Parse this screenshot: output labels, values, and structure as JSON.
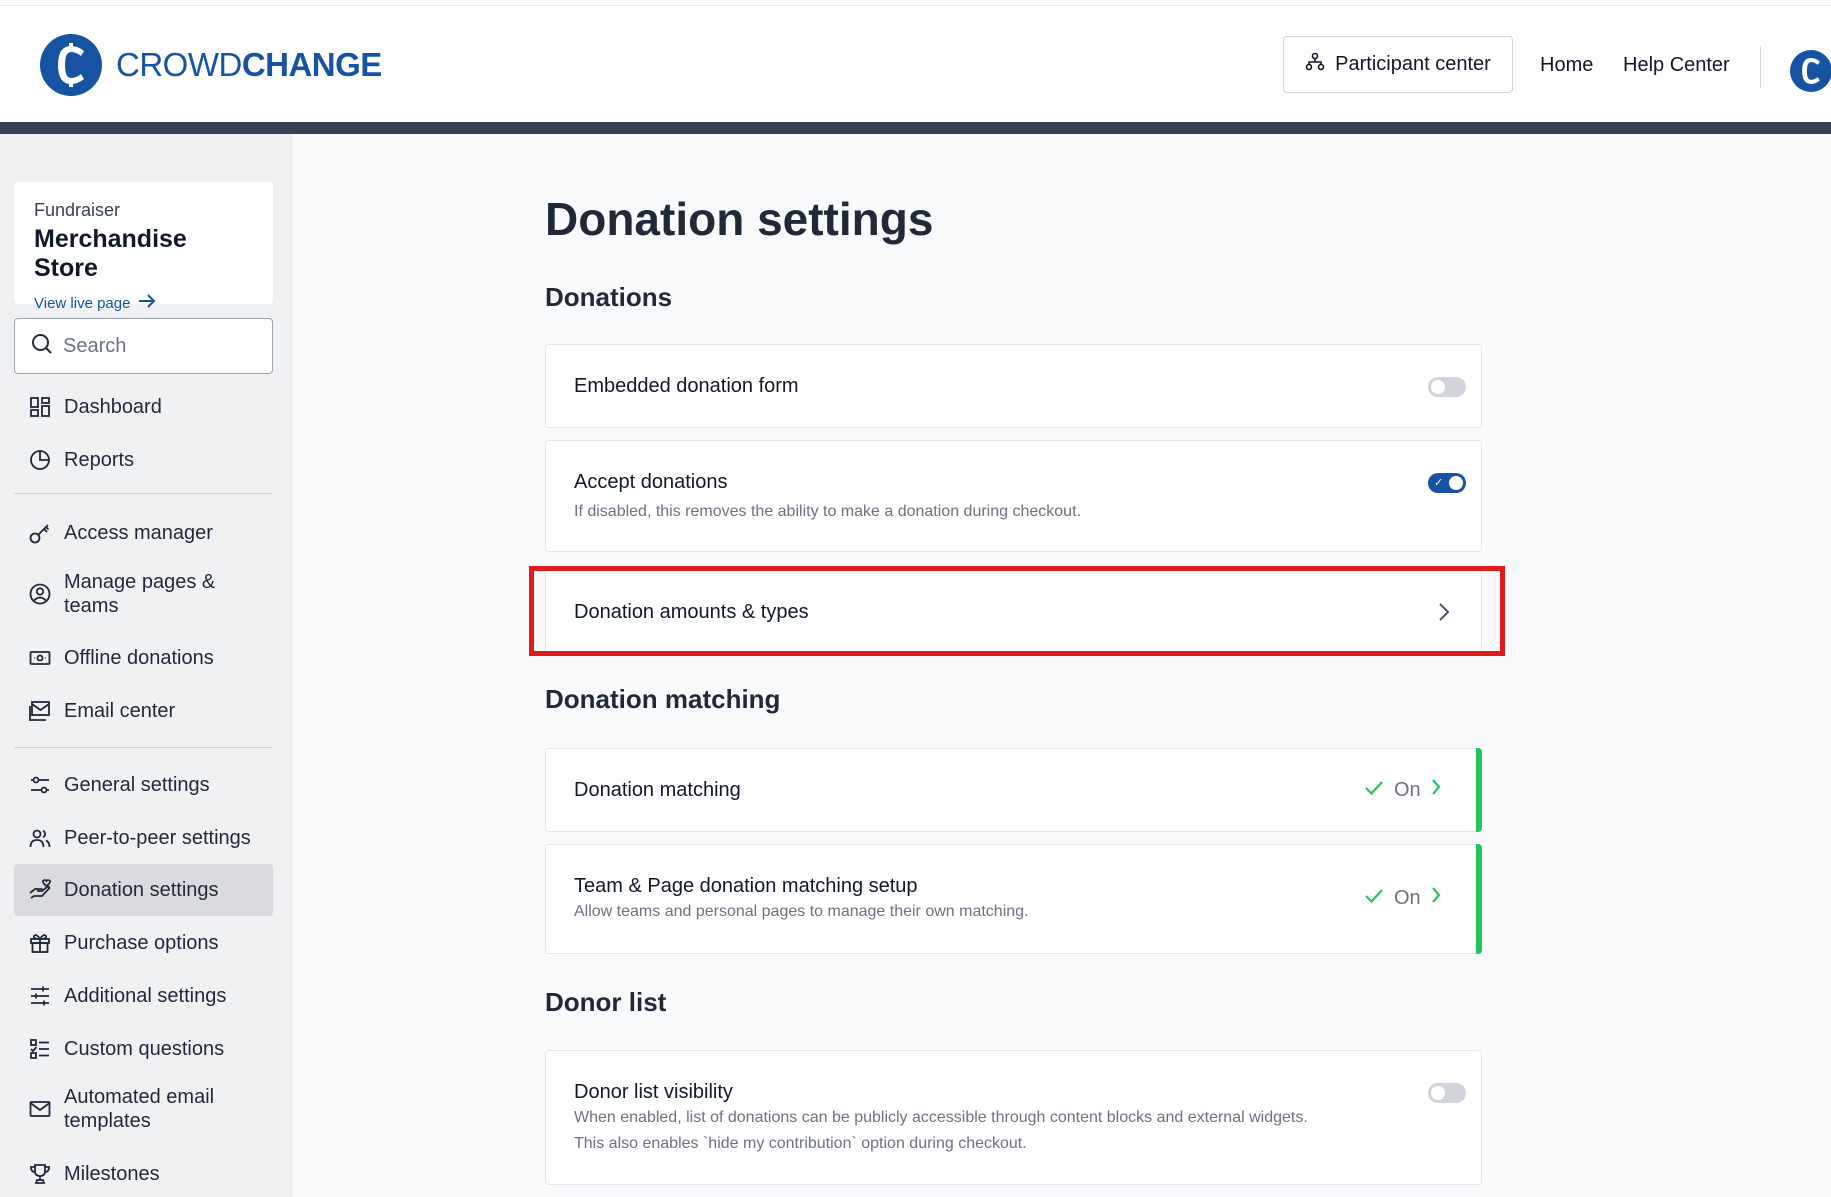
{
  "header": {
    "logo_part1": "CROWD",
    "logo_part2": "CHANGE",
    "participant_center": "Participant center",
    "home": "Home",
    "help_center": "Help Center"
  },
  "sidebar": {
    "fundraiser_label": "Fundraiser",
    "fundraiser_name": "Merchandise Store",
    "view_live": "View live page",
    "search_placeholder": "Search",
    "items": [
      {
        "label": "Dashboard",
        "icon": "dashboard-icon"
      },
      {
        "label": "Reports",
        "icon": "pie-chart-icon"
      },
      {
        "label": "Access manager",
        "icon": "key-icon"
      },
      {
        "label": "Manage pages & teams",
        "icon": "user-circle-icon"
      },
      {
        "label": "Offline donations",
        "icon": "cash-icon"
      },
      {
        "label": "Email center",
        "icon": "email-icon"
      },
      {
        "label": "General settings",
        "icon": "sliders-icon"
      },
      {
        "label": "Peer-to-peer settings",
        "icon": "users-icon"
      },
      {
        "label": "Donation settings",
        "icon": "hand-heart-icon"
      },
      {
        "label": "Purchase options",
        "icon": "gift-icon"
      },
      {
        "label": "Additional settings",
        "icon": "adjustments-icon"
      },
      {
        "label": "Custom questions",
        "icon": "checklist-icon"
      },
      {
        "label": "Automated email templates",
        "icon": "envelope-icon"
      },
      {
        "label": "Milestones",
        "icon": "trophy-icon"
      }
    ],
    "active_item": "Donation settings"
  },
  "main": {
    "page_title": "Donation settings",
    "sections": {
      "donations": "Donations",
      "matching": "Donation matching",
      "donor_list": "Donor list"
    },
    "embedded": {
      "title": "Embedded donation form",
      "enabled": false
    },
    "accept": {
      "title": "Accept donations",
      "subtitle": "If disabled, this removes the ability to make a donation during checkout.",
      "enabled": true
    },
    "amounts": {
      "title": "Donation amounts & types"
    },
    "matching_card": {
      "title": "Donation matching",
      "status": "On"
    },
    "team_matching": {
      "title": "Team & Page donation matching setup",
      "subtitle": "Allow teams and personal pages to manage their own matching.",
      "status": "On"
    },
    "donor_visibility": {
      "title": "Donor list visibility",
      "subtitle_line1": "When enabled, list of donations can be publicly accessible through content blocks and external widgets.",
      "subtitle_line2": "This also enables `hide my contribution` option during checkout.",
      "enabled": false
    }
  },
  "colors": {
    "brand": "#1654a3",
    "success": "#22c55e",
    "highlight": "#e01b1b"
  }
}
